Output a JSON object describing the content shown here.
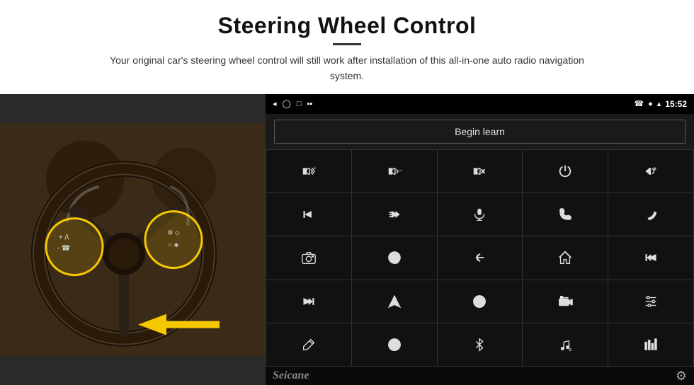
{
  "header": {
    "title": "Steering Wheel Control",
    "subtitle": "Your original car's steering wheel control will still work after installation of this all-in-one auto radio navigation system."
  },
  "status_bar": {
    "time": "15:52",
    "icons": [
      "back-icon",
      "home-icon",
      "recents-icon",
      "signal-icon",
      "location-icon",
      "wifi-icon",
      "phone-icon"
    ]
  },
  "begin_learn_button": {
    "label": "Begin learn"
  },
  "branding": {
    "logo": "Seicane"
  },
  "controls": [
    {
      "id": "vol-up",
      "label": "vol+"
    },
    {
      "id": "vol-down",
      "label": "vol-"
    },
    {
      "id": "mute",
      "label": "mute"
    },
    {
      "id": "power",
      "label": "power"
    },
    {
      "id": "prev-track-phone",
      "label": "prev+phone"
    },
    {
      "id": "next-track",
      "label": "next"
    },
    {
      "id": "fast-forward",
      "label": "fast-forward"
    },
    {
      "id": "mic",
      "label": "mic"
    },
    {
      "id": "phone",
      "label": "phone"
    },
    {
      "id": "hang-up",
      "label": "hang-up"
    },
    {
      "id": "camera",
      "label": "camera"
    },
    {
      "id": "360-view",
      "label": "360"
    },
    {
      "id": "back",
      "label": "back"
    },
    {
      "id": "home",
      "label": "home"
    },
    {
      "id": "skip-back",
      "label": "skip-back"
    },
    {
      "id": "skip-fwd",
      "label": "skip-fwd"
    },
    {
      "id": "navigate",
      "label": "navigate"
    },
    {
      "id": "eq",
      "label": "eq"
    },
    {
      "id": "radio",
      "label": "radio"
    },
    {
      "id": "settings-sliders",
      "label": "settings-sliders"
    },
    {
      "id": "pen",
      "label": "pen"
    },
    {
      "id": "compass",
      "label": "compass"
    },
    {
      "id": "bluetooth",
      "label": "bluetooth"
    },
    {
      "id": "music",
      "label": "music"
    },
    {
      "id": "equalizer",
      "label": "equalizer"
    }
  ]
}
